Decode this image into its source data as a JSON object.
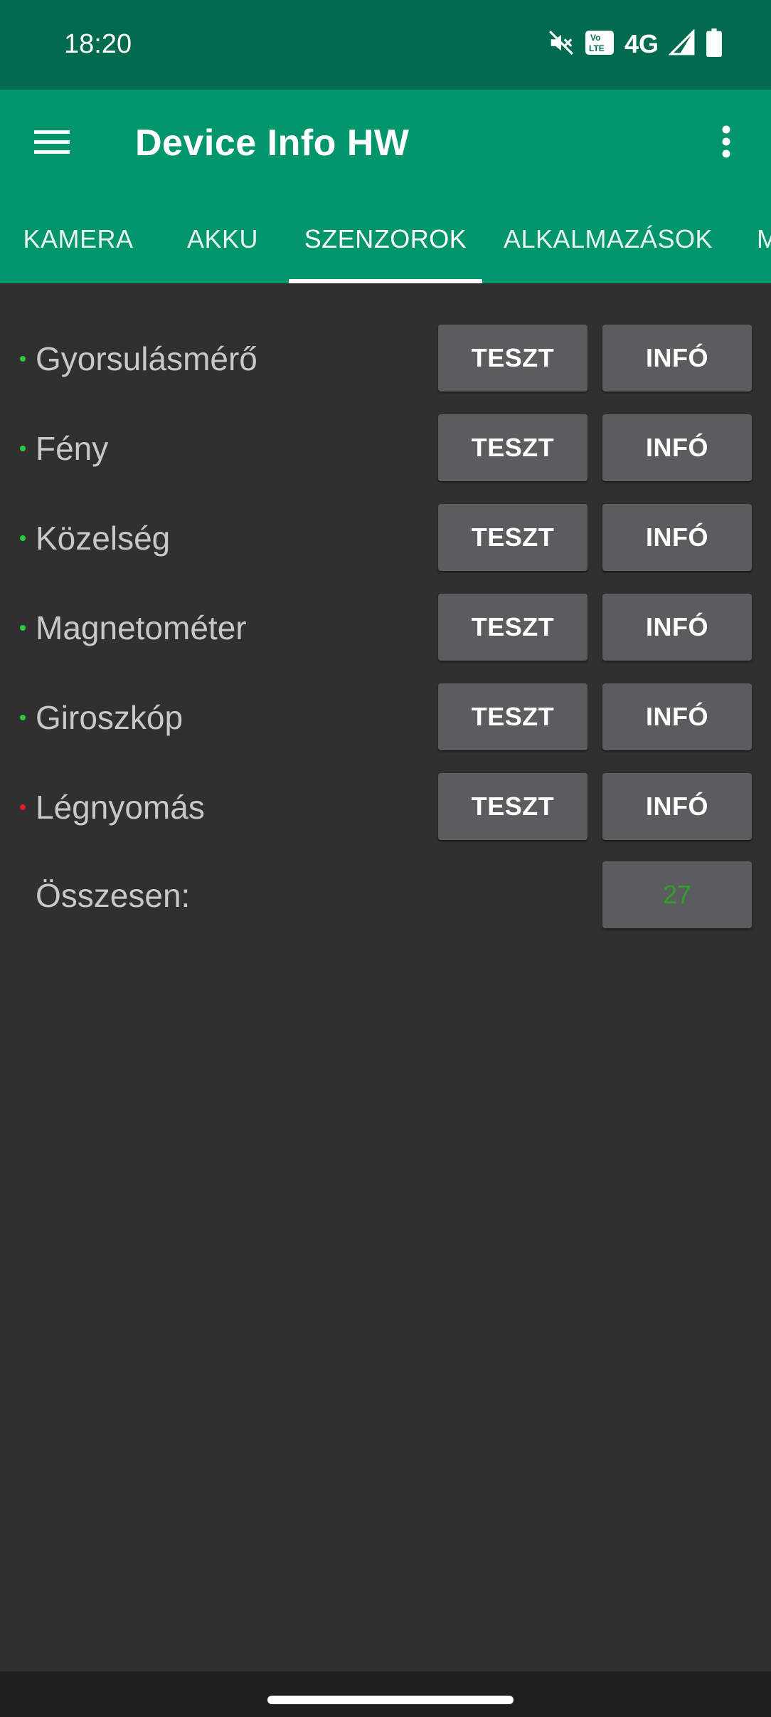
{
  "status_bar": {
    "time": "18:20",
    "network": "4G",
    "icons": [
      "mute-icon",
      "volte-icon",
      "signal-icon",
      "battery-icon"
    ],
    "volte_text": "Vo LTE"
  },
  "app_bar": {
    "title": "Device Info HW",
    "menu_icon": "hamburger-menu-icon",
    "overflow_icon": "more-vert-icon"
  },
  "tabs": [
    {
      "label": "KAMERA",
      "active": false
    },
    {
      "label": "AKKU",
      "active": false
    },
    {
      "label": "SZENZOROK",
      "active": true
    },
    {
      "label": "ALKALMAZÁSOK",
      "active": false
    },
    {
      "label": "M",
      "active": false
    }
  ],
  "sensors": [
    {
      "label": "Gyorsulásmérő",
      "status": "green",
      "test_label": "TESZT",
      "info_label": "INFÓ"
    },
    {
      "label": "Fény",
      "status": "green",
      "test_label": "TESZT",
      "info_label": "INFÓ"
    },
    {
      "label": "Közelség",
      "status": "green",
      "test_label": "TESZT",
      "info_label": "INFÓ"
    },
    {
      "label": "Magnetométer",
      "status": "green",
      "test_label": "TESZT",
      "info_label": "INFÓ"
    },
    {
      "label": "Giroszkóp",
      "status": "green",
      "test_label": "TESZT",
      "info_label": "INFÓ"
    },
    {
      "label": "Légnyomás",
      "status": "red",
      "test_label": "TESZT",
      "info_label": "INFÓ"
    }
  ],
  "total": {
    "label": "Összesen:",
    "value": "27"
  },
  "colors": {
    "status_bar": "#026b4f",
    "app_bar": "#03956c",
    "background": "#303030",
    "button": "#5c5c5e",
    "status_green": "#2ecc40",
    "status_red": "#e02020",
    "total_value": "#2e9e2e"
  }
}
